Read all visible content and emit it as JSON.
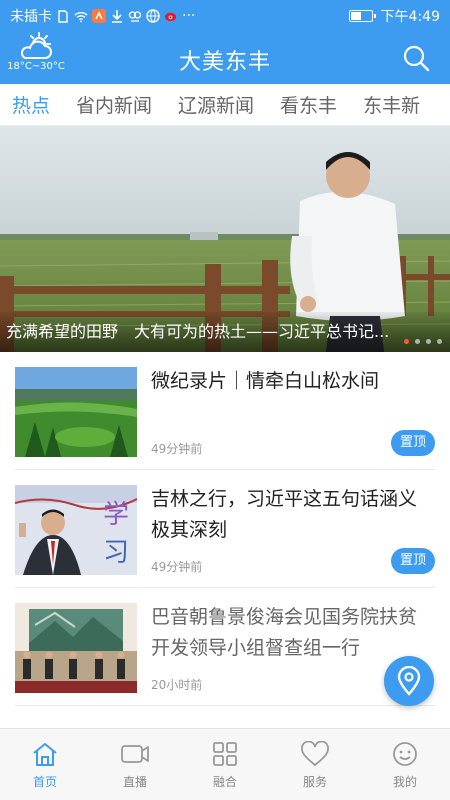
{
  "status_bar": {
    "carrier": "未插卡",
    "time": "下午4:49",
    "more": "···",
    "battery_level": 0.55
  },
  "header": {
    "title": "大美东丰",
    "weather_temp": "18°C~30°C",
    "weather_icon": "cloud-sun-icon",
    "search_icon": "search-icon"
  },
  "tabs": [
    {
      "label": "热点",
      "active": true
    },
    {
      "label": "省内新闻",
      "active": false
    },
    {
      "label": "辽源新闻",
      "active": false
    },
    {
      "label": "看东丰",
      "active": false
    },
    {
      "label": "东丰新",
      "active": false
    }
  ],
  "banner": {
    "caption": "充满希望的田野　大有可为的热土——习近平总书记...",
    "slide_count": 4,
    "active_slide": 1
  },
  "news": [
    {
      "title": "微纪录片｜情牵白山松水间",
      "time": "49分钟前",
      "badge": "置顶"
    },
    {
      "title": "吉林之行，习近平这五句话涵义极其深刻",
      "time": "49分钟前",
      "badge": "置顶"
    },
    {
      "title": "巴音朝鲁景俊海会见国务院扶贫开发领导小组督查组一行",
      "time": "20小时前",
      "badge": ""
    }
  ],
  "thumb_text": {
    "xue": "学",
    "xi": "习"
  },
  "bottom_nav": [
    {
      "label": "首页",
      "icon": "home-icon",
      "active": true
    },
    {
      "label": "直播",
      "icon": "video-camera-icon",
      "active": false
    },
    {
      "label": "融合",
      "icon": "grid-icon",
      "active": false
    },
    {
      "label": "服务",
      "icon": "heart-icon",
      "active": false
    },
    {
      "label": "我的",
      "icon": "smiley-icon",
      "active": false
    }
  ],
  "colors": {
    "accent": "#3d9cf0",
    "pin": "#3d9cf0",
    "inactive": "#888888"
  }
}
